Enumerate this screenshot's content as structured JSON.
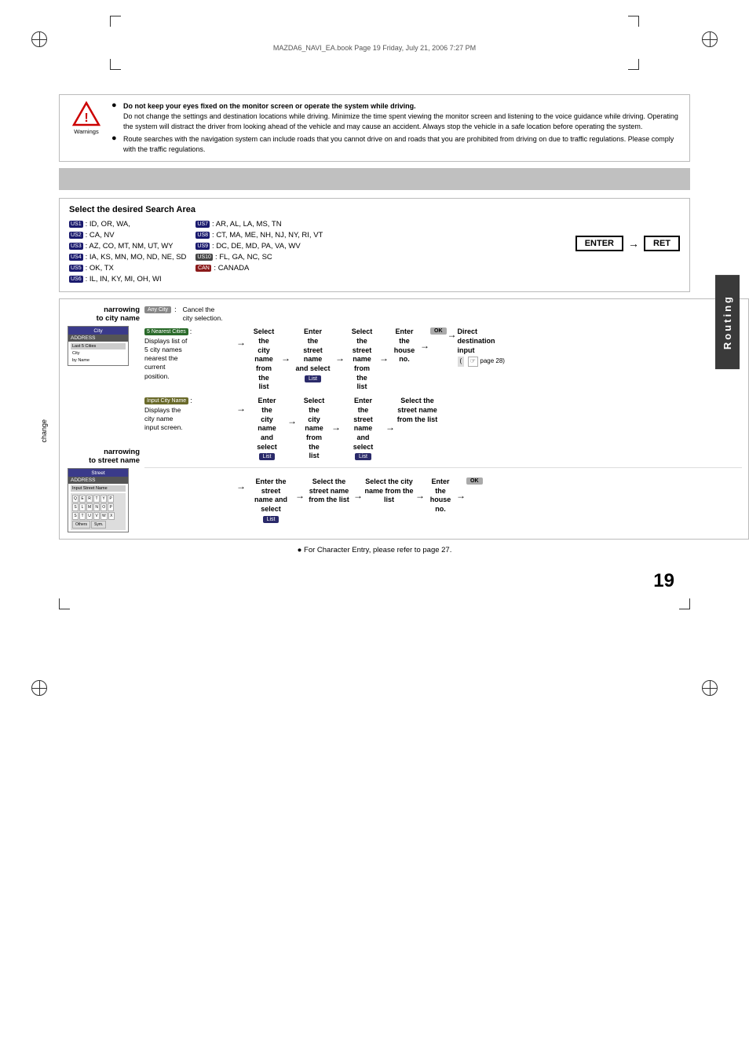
{
  "page": {
    "number": "19",
    "book_info": "MAZDA6_NAVI_EA.book   Page 19   Friday, July 21, 2006   7:27 PM",
    "routing_label": "Routing"
  },
  "warning": {
    "icon_label": "Warnings",
    "bold_line": "Do not keep your eyes fixed on the monitor screen or operate the system while driving.",
    "line1": "Do not change the settings and destination locations while driving. Minimize the time spent viewing the monitor screen and listening to the voice guidance while driving. Operating the system will distract the driver from looking ahead of the vehicle and may cause an accident. Always stop the vehicle in a safe location before operating the system.",
    "bullet2": "Route searches with the navigation system can include roads that you cannot drive on and roads that you are prohibited from driving on due to traffic regulations. Please comply with the traffic regulations."
  },
  "search_area": {
    "title": "Select the desired Search Area",
    "us1": "US1",
    "us1_states": ": ID, OR, WA,",
    "us2": "US2",
    "us2_states": ": CA, NV",
    "us3": "US3",
    "us3_states": ": AZ, CO, MT, NM, UT, WY",
    "us4": "US4",
    "us4_states": ": IA, KS, MN, MO, ND, NE, SD",
    "us5": "US5",
    "us5_states": ": OK, TX",
    "us6": "US6",
    "us6_states": ": IL, IN, KY, MI, OH, WI",
    "us7": "US7",
    "us7_states": ": AR, AL, LA, MS, TN",
    "us8": "US8",
    "us8_states": ": CT, MA, ME, NH, NJ, NY, RI, VT",
    "us9": "US9",
    "us9_states": ": DC, DE, MD, PA, VA, WV",
    "us10": "US10",
    "us10_states": ": FL, GA, NC, SC",
    "can": "CAN",
    "can_states": ": CANADA",
    "enter_label": "ENTER",
    "ret_label": "RET",
    "change_label": "change"
  },
  "city_flow": {
    "narrowing_title1": "narrowing",
    "narrowing_title2": "to city name",
    "screen_city": "City",
    "screen_address": "ADDRESS",
    "screen_last5cities": "Last 5 Cities",
    "screen_city_label": "City",
    "screen_by_name": "by Name",
    "anycity_btn": "Any City",
    "cancel_desc1": "Cancel the",
    "cancel_desc2": "city selection.",
    "nearest5_btn": "5 Nearest Cities",
    "nearest5_desc1": "Displays list of",
    "nearest5_desc2": "5 city names",
    "nearest5_desc3": "nearest the",
    "nearest5_desc4": "current",
    "nearest5_desc5": "position.",
    "inputcity_btn": "Input City Name",
    "inputcity_desc1": "Displays the",
    "inputcity_desc2": "city name",
    "inputcity_desc3": "input screen.",
    "select_city_from_list": "Select the city name from the list",
    "enter_street_label": "Enter the street name and select",
    "select_street_from_list": "Select the street name from the list",
    "enter_house_label": "Enter the house no.",
    "select_ok": "OK",
    "direct_dest": "Direct destination input",
    "page_ref": "( page 28)",
    "flow1_select": "Select\nthe\ncity\nname\nfrom\nthe\nlist",
    "flow1_enter": "Enter\nthe\nstreet\nname\nand select",
    "flow1_select2": "Select\nthe\nstreet\nname\nfrom\nthe\nlist",
    "flow1_enter2": "Enter\nthe\nhouse\nno.",
    "flow2_enter": "Enter\nthe\ncity\nname\nand\nselect",
    "flow2_select": "Select\nthe\ncity\nname\nfrom\nthe\nlist",
    "flow2_enter2": "Enter\nthe\nstreet\nname\nand\nselect",
    "flow2_select2": "Select the\nstreet name\nfrom the list",
    "list_btn": "List"
  },
  "street_flow": {
    "narrowing_title1": "narrowing",
    "narrowing_title2": "to street name",
    "screen_street": "Street",
    "screen_address": "ADDRESS",
    "screen_input_street": "Input Street Name",
    "enter_street": "Enter the street name and select",
    "list_btn": "List",
    "select_street": "Select the street name from the list",
    "select_city": "Select the city name from the list",
    "enter_house": "Enter the house no.",
    "select_ok": "OK"
  },
  "footer": {
    "char_entry_note": "● For Character Entry, please refer to page 27."
  }
}
